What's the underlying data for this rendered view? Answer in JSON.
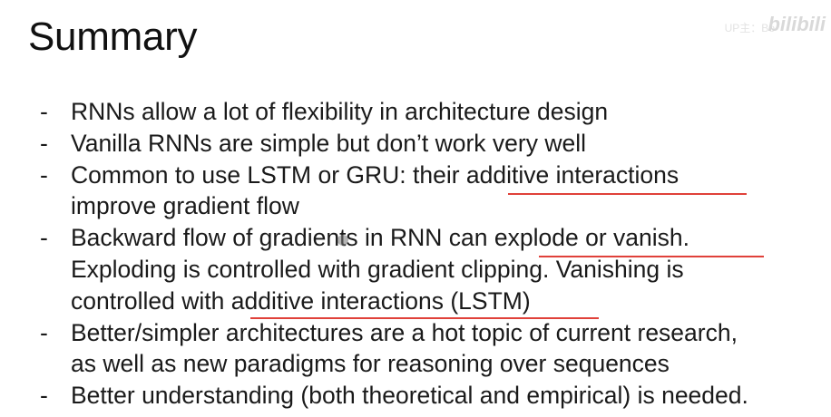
{
  "slide": {
    "title": "Summary",
    "watermark": "bilibili",
    "watermark_sub": "UP主：Bo",
    "bullet_marker": "-",
    "bullets": [
      {
        "lines": [
          "RNNs allow a lot of flexibility in architecture design"
        ]
      },
      {
        "lines": [
          "Vanilla RNNs are simple but don’t work very well"
        ]
      },
      {
        "lines": [
          "Common to use LSTM or GRU: their additive interactions",
          "improve gradient flow"
        ]
      },
      {
        "lines": [
          "Backward flow of gradients in RNN can explode or vanish.",
          "Exploding is controlled with gradient clipping. Vanishing is",
          "controlled with additive interactions (LSTM)"
        ]
      },
      {
        "lines": [
          "Better/simpler architectures are a hot topic of current research,",
          "as well as new paradigms for reasoning over sequences"
        ]
      },
      {
        "lines": [
          "Better understanding (both theoretical and empirical) is needed."
        ]
      }
    ],
    "annotation_color": "#e0413a"
  }
}
